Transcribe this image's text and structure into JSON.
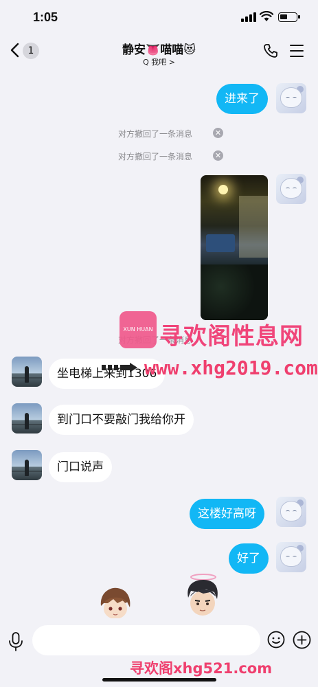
{
  "status_bar": {
    "time": "1:05"
  },
  "header": {
    "back_count": "1",
    "title": "静安👅喵喵😻",
    "subtitle": "Q 我吧 >"
  },
  "messages": [
    {
      "id": "m1",
      "direction": "out",
      "type": "text",
      "text": "进来了"
    },
    {
      "id": "m2",
      "type": "system",
      "text": "对方撤回了一条消息"
    },
    {
      "id": "m3",
      "type": "system",
      "text": "对方撤回了一条消息"
    },
    {
      "id": "m4",
      "direction": "out",
      "type": "image"
    },
    {
      "id": "m5",
      "type": "system",
      "text": "对方撤回了一条消息"
    },
    {
      "id": "m6",
      "direction": "in",
      "type": "text",
      "text": "坐电梯上来到1306"
    },
    {
      "id": "m7",
      "direction": "in",
      "type": "text",
      "text": "到门口不要敲门我给你开"
    },
    {
      "id": "m8",
      "direction": "in",
      "type": "text",
      "text": "门口说声"
    },
    {
      "id": "m9",
      "direction": "out",
      "type": "text",
      "text": "这楼好高呀"
    },
    {
      "id": "m10",
      "direction": "out",
      "type": "text",
      "text": "好了"
    }
  ],
  "watermarks": {
    "logo_text": "XUN HUAN",
    "title": "寻欢阁性息网",
    "url": "www.xhg2019.com",
    "bottom": "寻欢阁xhg521.com"
  },
  "input": {
    "placeholder": ""
  },
  "icons": {
    "back": "chevron-left-icon",
    "phone": "phone-icon",
    "menu": "hamburger-menu-icon",
    "mic": "microphone-icon",
    "emoji": "smiley-icon",
    "plus": "plus-circle-icon",
    "dismiss": "close-circle-icon"
  },
  "colors": {
    "background": "#f2f2f7",
    "outgoing_bubble": "#12b7f5",
    "incoming_bubble": "#ffffff",
    "watermark": "#ef3f6e"
  }
}
